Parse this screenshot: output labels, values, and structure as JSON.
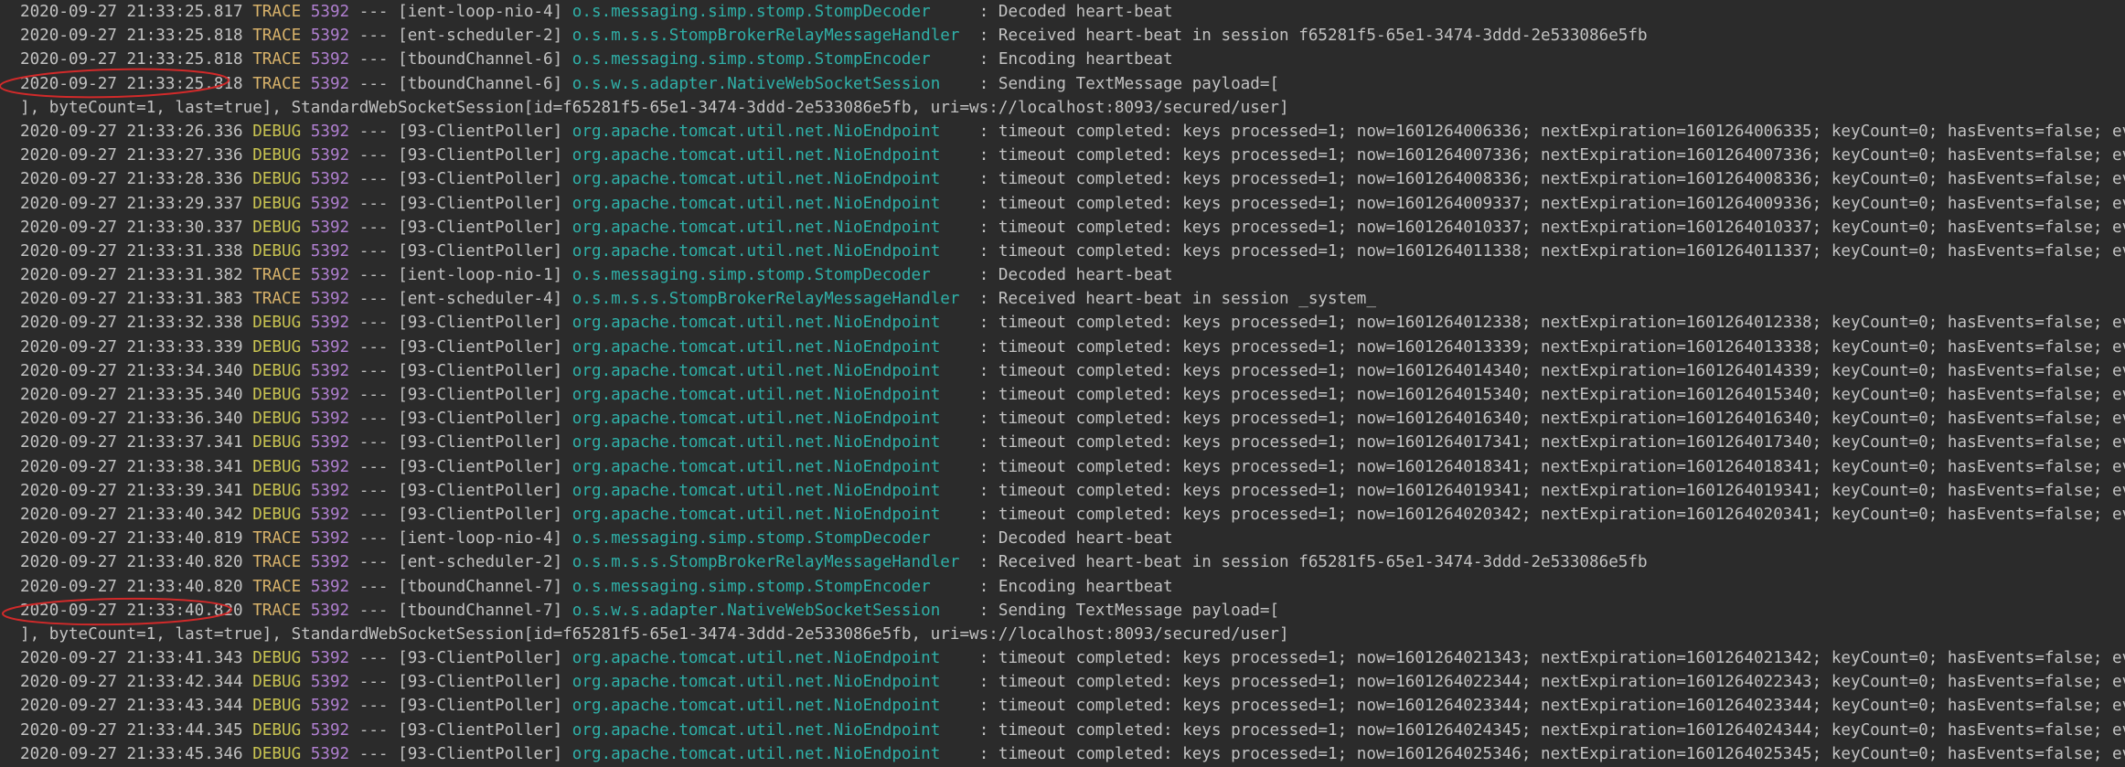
{
  "console": {
    "level_colors": {
      "TRACE": "#d8b26a",
      "DEBUG": "#c9c451"
    },
    "pid_color": "#b07fd0",
    "logger_color": "#2fb0a8",
    "text_color": "#c2c2c2",
    "background": "#2b2b2b",
    "annotation_color": "#d12a2a",
    "lines": [
      {
        "type": "entry",
        "ts": "2020-09-27 21:33:25.817",
        "level": "TRACE",
        "pid": "5392",
        "thread": "[ient-loop-nio-4]",
        "logger": "o.s.messaging.simp.stomp.StompDecoder    ",
        "msg": ": Decoded heart-beat"
      },
      {
        "type": "entry",
        "ts": "2020-09-27 21:33:25.818",
        "level": "TRACE",
        "pid": "5392",
        "thread": "[ent-scheduler-2]",
        "logger": "o.s.m.s.s.StompBrokerRelayMessageHandler ",
        "msg": ": Received heart-beat in session f65281f5-65e1-3474-3ddd-2e533086e5fb"
      },
      {
        "type": "entry",
        "ts": "2020-09-27 21:33:25.818",
        "level": "TRACE",
        "pid": "5392",
        "thread": "[tboundChannel-6]",
        "logger": "o.s.messaging.simp.stomp.StompEncoder    ",
        "msg": ": Encoding heartbeat"
      },
      {
        "type": "entry",
        "ts": "2020-09-27 21:33:25.818",
        "level": "TRACE",
        "pid": "5392",
        "thread": "[tboundChannel-6]",
        "logger": "o.s.w.s.adapter.NativeWebSocketSession   ",
        "msg": ": Sending TextMessage payload=["
      },
      {
        "type": "cont",
        "text": "], byteCount=1, last=true], StandardWebSocketSession[id=f65281f5-65e1-3474-3ddd-2e533086e5fb, uri=ws://localhost:8093/secured/user]"
      },
      {
        "type": "entry",
        "ts": "2020-09-27 21:33:26.336",
        "level": "DEBUG",
        "pid": "5392",
        "thread": "[93-ClientPoller]",
        "logger": "org.apache.tomcat.util.net.NioEndpoint   ",
        "msg": ": timeout completed: keys processed=1; now=1601264006336; nextExpiration=1601264006335; keyCount=0; hasEvents=false; eval=false"
      },
      {
        "type": "entry",
        "ts": "2020-09-27 21:33:27.336",
        "level": "DEBUG",
        "pid": "5392",
        "thread": "[93-ClientPoller]",
        "logger": "org.apache.tomcat.util.net.NioEndpoint   ",
        "msg": ": timeout completed: keys processed=1; now=1601264007336; nextExpiration=1601264007336; keyCount=0; hasEvents=false; eval=false"
      },
      {
        "type": "entry",
        "ts": "2020-09-27 21:33:28.336",
        "level": "DEBUG",
        "pid": "5392",
        "thread": "[93-ClientPoller]",
        "logger": "org.apache.tomcat.util.net.NioEndpoint   ",
        "msg": ": timeout completed: keys processed=1; now=1601264008336; nextExpiration=1601264008336; keyCount=0; hasEvents=false; eval=false"
      },
      {
        "type": "entry",
        "ts": "2020-09-27 21:33:29.337",
        "level": "DEBUG",
        "pid": "5392",
        "thread": "[93-ClientPoller]",
        "logger": "org.apache.tomcat.util.net.NioEndpoint   ",
        "msg": ": timeout completed: keys processed=1; now=1601264009337; nextExpiration=1601264009336; keyCount=0; hasEvents=false; eval=false"
      },
      {
        "type": "entry",
        "ts": "2020-09-27 21:33:30.337",
        "level": "DEBUG",
        "pid": "5392",
        "thread": "[93-ClientPoller]",
        "logger": "org.apache.tomcat.util.net.NioEndpoint   ",
        "msg": ": timeout completed: keys processed=1; now=1601264010337; nextExpiration=1601264010337; keyCount=0; hasEvents=false; eval=false"
      },
      {
        "type": "entry",
        "ts": "2020-09-27 21:33:31.338",
        "level": "DEBUG",
        "pid": "5392",
        "thread": "[93-ClientPoller]",
        "logger": "org.apache.tomcat.util.net.NioEndpoint   ",
        "msg": ": timeout completed: keys processed=1; now=1601264011338; nextExpiration=1601264011337; keyCount=0; hasEvents=false; eval=false"
      },
      {
        "type": "entry",
        "ts": "2020-09-27 21:33:31.382",
        "level": "TRACE",
        "pid": "5392",
        "thread": "[ient-loop-nio-1]",
        "logger": "o.s.messaging.simp.stomp.StompDecoder    ",
        "msg": ": Decoded heart-beat"
      },
      {
        "type": "entry",
        "ts": "2020-09-27 21:33:31.383",
        "level": "TRACE",
        "pid": "5392",
        "thread": "[ent-scheduler-4]",
        "logger": "o.s.m.s.s.StompBrokerRelayMessageHandler ",
        "msg": ": Received heart-beat in session _system_"
      },
      {
        "type": "entry",
        "ts": "2020-09-27 21:33:32.338",
        "level": "DEBUG",
        "pid": "5392",
        "thread": "[93-ClientPoller]",
        "logger": "org.apache.tomcat.util.net.NioEndpoint   ",
        "msg": ": timeout completed: keys processed=1; now=1601264012338; nextExpiration=1601264012338; keyCount=0; hasEvents=false; eval=false"
      },
      {
        "type": "entry",
        "ts": "2020-09-27 21:33:33.339",
        "level": "DEBUG",
        "pid": "5392",
        "thread": "[93-ClientPoller]",
        "logger": "org.apache.tomcat.util.net.NioEndpoint   ",
        "msg": ": timeout completed: keys processed=1; now=1601264013339; nextExpiration=1601264013338; keyCount=0; hasEvents=false; eval=false"
      },
      {
        "type": "entry",
        "ts": "2020-09-27 21:33:34.340",
        "level": "DEBUG",
        "pid": "5392",
        "thread": "[93-ClientPoller]",
        "logger": "org.apache.tomcat.util.net.NioEndpoint   ",
        "msg": ": timeout completed: keys processed=1; now=1601264014340; nextExpiration=1601264014339; keyCount=0; hasEvents=false; eval=false"
      },
      {
        "type": "entry",
        "ts": "2020-09-27 21:33:35.340",
        "level": "DEBUG",
        "pid": "5392",
        "thread": "[93-ClientPoller]",
        "logger": "org.apache.tomcat.util.net.NioEndpoint   ",
        "msg": ": timeout completed: keys processed=1; now=1601264015340; nextExpiration=1601264015340; keyCount=0; hasEvents=false; eval=false"
      },
      {
        "type": "entry",
        "ts": "2020-09-27 21:33:36.340",
        "level": "DEBUG",
        "pid": "5392",
        "thread": "[93-ClientPoller]",
        "logger": "org.apache.tomcat.util.net.NioEndpoint   ",
        "msg": ": timeout completed: keys processed=1; now=1601264016340; nextExpiration=1601264016340; keyCount=0; hasEvents=false; eval=false"
      },
      {
        "type": "entry",
        "ts": "2020-09-27 21:33:37.341",
        "level": "DEBUG",
        "pid": "5392",
        "thread": "[93-ClientPoller]",
        "logger": "org.apache.tomcat.util.net.NioEndpoint   ",
        "msg": ": timeout completed: keys processed=1; now=1601264017341; nextExpiration=1601264017340; keyCount=0; hasEvents=false; eval=false"
      },
      {
        "type": "entry",
        "ts": "2020-09-27 21:33:38.341",
        "level": "DEBUG",
        "pid": "5392",
        "thread": "[93-ClientPoller]",
        "logger": "org.apache.tomcat.util.net.NioEndpoint   ",
        "msg": ": timeout completed: keys processed=1; now=1601264018341; nextExpiration=1601264018341; keyCount=0; hasEvents=false; eval=false"
      },
      {
        "type": "entry",
        "ts": "2020-09-27 21:33:39.341",
        "level": "DEBUG",
        "pid": "5392",
        "thread": "[93-ClientPoller]",
        "logger": "org.apache.tomcat.util.net.NioEndpoint   ",
        "msg": ": timeout completed: keys processed=1; now=1601264019341; nextExpiration=1601264019341; keyCount=0; hasEvents=false; eval=false"
      },
      {
        "type": "entry",
        "ts": "2020-09-27 21:33:40.342",
        "level": "DEBUG",
        "pid": "5392",
        "thread": "[93-ClientPoller]",
        "logger": "org.apache.tomcat.util.net.NioEndpoint   ",
        "msg": ": timeout completed: keys processed=1; now=1601264020342; nextExpiration=1601264020341; keyCount=0; hasEvents=false; eval=false"
      },
      {
        "type": "entry",
        "ts": "2020-09-27 21:33:40.819",
        "level": "TRACE",
        "pid": "5392",
        "thread": "[ient-loop-nio-4]",
        "logger": "o.s.messaging.simp.stomp.StompDecoder    ",
        "msg": ": Decoded heart-beat"
      },
      {
        "type": "entry",
        "ts": "2020-09-27 21:33:40.820",
        "level": "TRACE",
        "pid": "5392",
        "thread": "[ent-scheduler-2]",
        "logger": "o.s.m.s.s.StompBrokerRelayMessageHandler ",
        "msg": ": Received heart-beat in session f65281f5-65e1-3474-3ddd-2e533086e5fb"
      },
      {
        "type": "entry",
        "ts": "2020-09-27 21:33:40.820",
        "level": "TRACE",
        "pid": "5392",
        "thread": "[tboundChannel-7]",
        "logger": "o.s.messaging.simp.stomp.StompEncoder    ",
        "msg": ": Encoding heartbeat"
      },
      {
        "type": "entry",
        "ts": "2020-09-27 21:33:40.820",
        "level": "TRACE",
        "pid": "5392",
        "thread": "[tboundChannel-7]",
        "logger": "o.s.w.s.adapter.NativeWebSocketSession   ",
        "msg": ": Sending TextMessage payload=["
      },
      {
        "type": "cont",
        "text": "], byteCount=1, last=true], StandardWebSocketSession[id=f65281f5-65e1-3474-3ddd-2e533086e5fb, uri=ws://localhost:8093/secured/user]"
      },
      {
        "type": "entry",
        "ts": "2020-09-27 21:33:41.343",
        "level": "DEBUG",
        "pid": "5392",
        "thread": "[93-ClientPoller]",
        "logger": "org.apache.tomcat.util.net.NioEndpoint   ",
        "msg": ": timeout completed: keys processed=1; now=1601264021343; nextExpiration=1601264021342; keyCount=0; hasEvents=false; eval=false"
      },
      {
        "type": "entry",
        "ts": "2020-09-27 21:33:42.344",
        "level": "DEBUG",
        "pid": "5392",
        "thread": "[93-ClientPoller]",
        "logger": "org.apache.tomcat.util.net.NioEndpoint   ",
        "msg": ": timeout completed: keys processed=1; now=1601264022344; nextExpiration=1601264022343; keyCount=0; hasEvents=false; eval=false"
      },
      {
        "type": "entry",
        "ts": "2020-09-27 21:33:43.344",
        "level": "DEBUG",
        "pid": "5392",
        "thread": "[93-ClientPoller]",
        "logger": "org.apache.tomcat.util.net.NioEndpoint   ",
        "msg": ": timeout completed: keys processed=1; now=1601264023344; nextExpiration=1601264023344; keyCount=0; hasEvents=false; eval=false"
      },
      {
        "type": "entry",
        "ts": "2020-09-27 21:33:44.345",
        "level": "DEBUG",
        "pid": "5392",
        "thread": "[93-ClientPoller]",
        "logger": "org.apache.tomcat.util.net.NioEndpoint   ",
        "msg": ": timeout completed: keys processed=1; now=1601264024345; nextExpiration=1601264024344; keyCount=0; hasEvents=false; eval=false"
      },
      {
        "type": "entry",
        "ts": "2020-09-27 21:33:45.346",
        "level": "DEBUG",
        "pid": "5392",
        "thread": "[93-ClientPoller]",
        "logger": "org.apache.tomcat.util.net.NioEndpoint   ",
        "msg": ": timeout completed: keys processed=1; now=1601264025346; nextExpiration=1601264025345; keyCount=0; hasEvents=false; eval=false"
      }
    ]
  }
}
